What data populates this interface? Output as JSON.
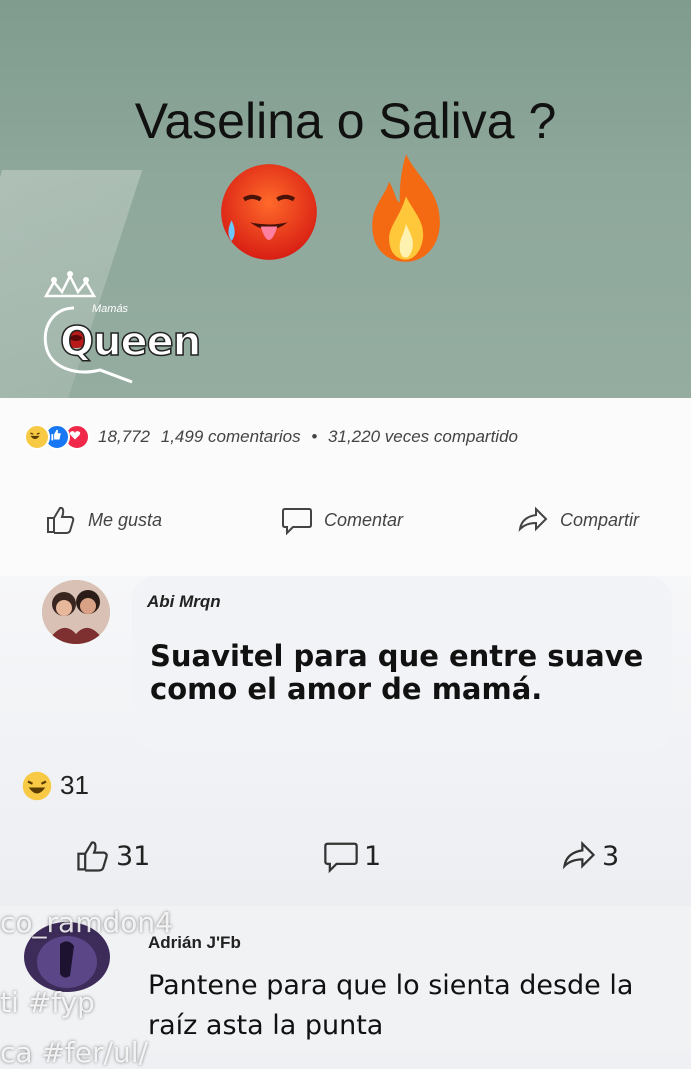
{
  "post": {
    "headline": "Vaselina o Saliva ?",
    "logo_text": "Queen",
    "logo_small": "Mamás"
  },
  "stats": {
    "reactions_count": "18,772",
    "comments": "1,499 comentarios",
    "separator": "•",
    "shares": "31,220 veces compartido"
  },
  "actions": {
    "like": "Me gusta",
    "comment": "Comentar",
    "share": "Compartir"
  },
  "comments": [
    {
      "author": "Abi Mrqn",
      "text": "Suavitel para que entre suave como el amor de mamá.",
      "laugh_count": "31",
      "likes": "31",
      "replies": "1",
      "shares": "3"
    },
    {
      "author": "Adrián J'Fb",
      "text": "Pantene para que lo sienta desde la raíz asta la punta"
    }
  ],
  "overlay": {
    "user": "co_ramdon4",
    "tags": "ti #fyp",
    "bottom": "ca #fer/ul/"
  }
}
